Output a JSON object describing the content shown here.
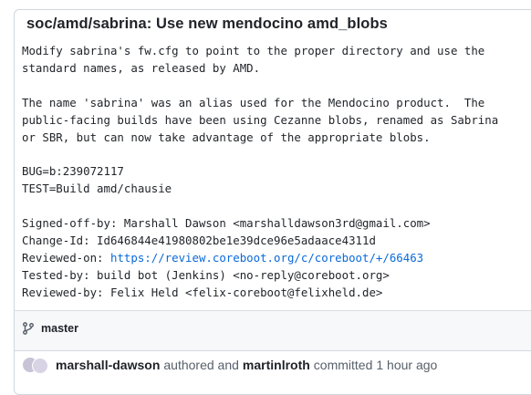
{
  "commit": {
    "title": "soc/amd/sabrina: Use new mendocino amd_blobs",
    "message_lines": [
      "Modify sabrina's fw.cfg to point to the proper directory and use the",
      "standard names, as released by AMD.",
      "",
      "The name 'sabrina' was an alias used for the Mendocino product.  The",
      "public-facing builds have been using Cezanne blobs, renamed as Sabrina",
      "or SBR, but can now take advantage of the appropriate blobs.",
      "",
      "BUG=b:239072117",
      "TEST=Build amd/chausie",
      "",
      "Signed-off-by: Marshall Dawson <marshalldawson3rd@gmail.com>",
      "Change-Id: Id646844e41980802be1e39dce96e5adaace4311d"
    ],
    "reviewed_on_label": "Reviewed-on: ",
    "reviewed_on_link": "https://review.coreboot.org/c/coreboot/+/66463",
    "trailer_lines": [
      "Tested-by: build bot (Jenkins) <no-reply@coreboot.org>",
      "Reviewed-by: Felix Held <felix-coreboot@felixheld.de>"
    ]
  },
  "branch": {
    "icon": "git-branch-icon",
    "name": "master"
  },
  "byline": {
    "author": "marshall-dawson",
    "authored_text": "authored and",
    "committer": "martinlroth",
    "committed_text": "committed",
    "time": "1 hour ago"
  }
}
